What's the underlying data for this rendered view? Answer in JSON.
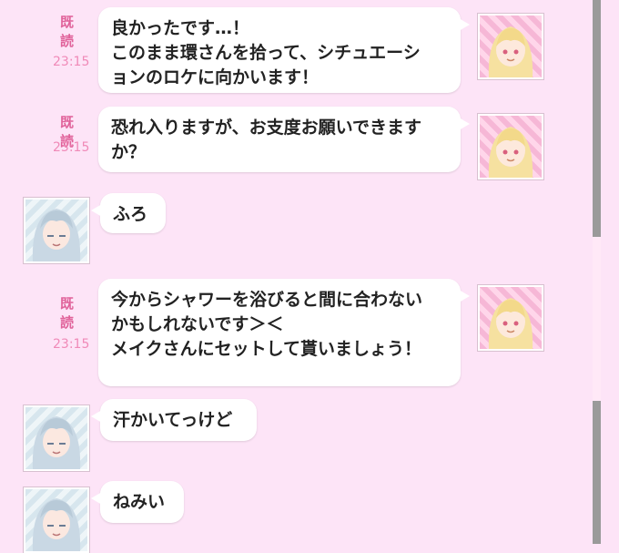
{
  "read_label": "既読",
  "messages": [
    {
      "side": "right",
      "text": "良かったです…！\nこのまま環さんを拾って、シチュエーシ\nョンのロケに向かいます！",
      "time": "23:15",
      "read": true,
      "avatar": "pink-hair-avatar"
    },
    {
      "side": "right",
      "text": "恐れ入りますが、お支度お願いできます\nか？",
      "time": "23:15",
      "read": true,
      "avatar": "pink-hair-avatar"
    },
    {
      "side": "left",
      "text": "ふろ",
      "avatar": "silver-hair-avatar"
    },
    {
      "side": "right",
      "text": "今からシャワーを浴びると間に合わない\nかもしれないです＞＜\nメイクさんにセットして貰いましょう！",
      "time": "23:15",
      "read": true,
      "avatar": "pink-hair-avatar"
    },
    {
      "side": "left",
      "text": "汗かいてっけど",
      "avatar": "silver-hair-avatar"
    },
    {
      "side": "left",
      "text": "ねみい",
      "avatar": "silver-hair-avatar"
    }
  ],
  "colors": {
    "background": "#fde4f7",
    "read": "#e0629a",
    "time": "#f08ab8",
    "scrollbar": "#9a9a9a"
  }
}
